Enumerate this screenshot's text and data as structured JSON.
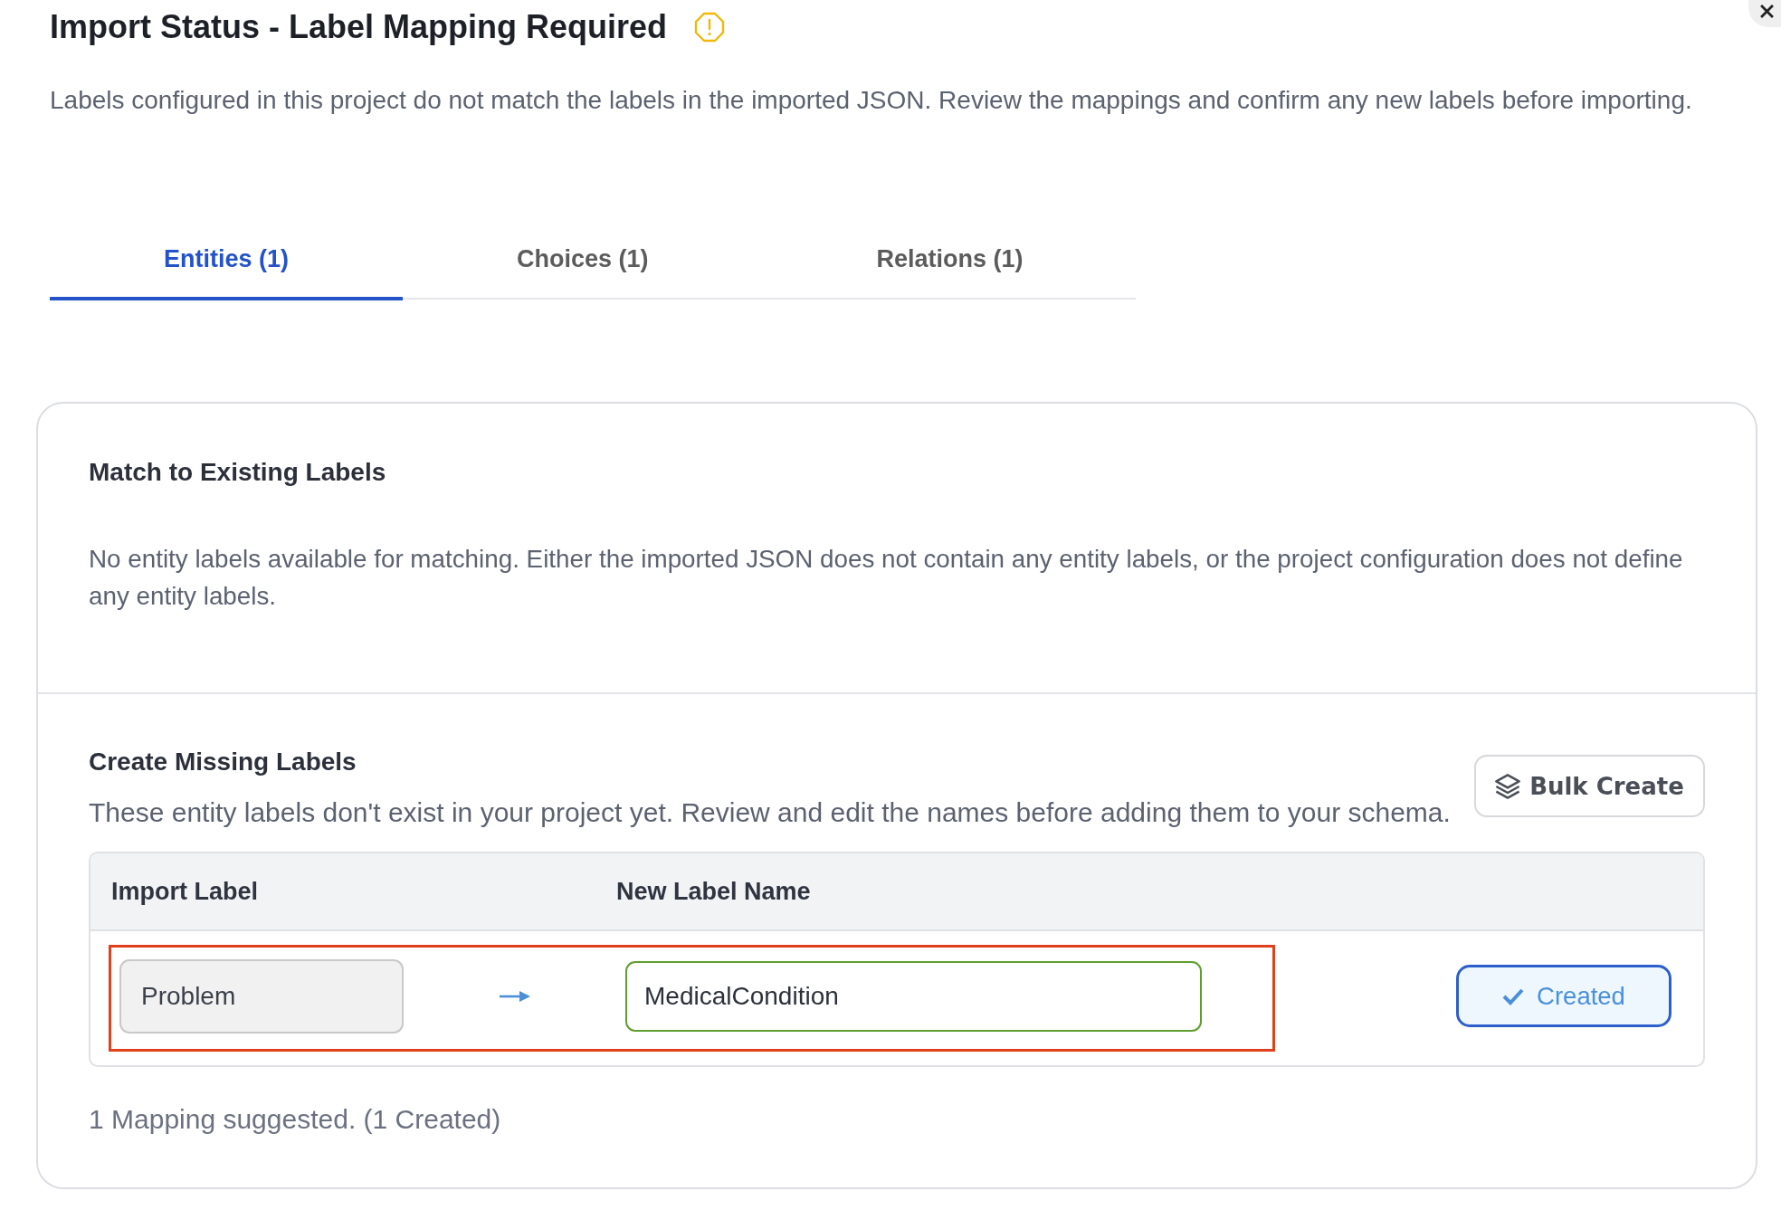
{
  "dialog": {
    "title": "Import Status - Label Mapping Required",
    "description": "Labels configured in this project do not match the labels in the imported JSON. Review the mappings and confirm any new labels before importing."
  },
  "tabs": [
    {
      "label": "Entities (1)",
      "selected": true
    },
    {
      "label": "Choices (1)",
      "selected": false
    },
    {
      "label": "Relations (1)",
      "selected": false
    }
  ],
  "match_section": {
    "title": "Match to Existing Labels",
    "message": "No entity labels available for matching. Either the imported JSON does not contain any entity labels, or the project configuration does not define any entity labels."
  },
  "create_section": {
    "title": "Create Missing Labels",
    "description": "These entity labels don't exist in your project yet. Review and edit the names before adding them to your schema.",
    "bulk_button": "Bulk Create",
    "table": {
      "columns": [
        "Import Label",
        "New Label Name"
      ],
      "rows": [
        {
          "import_label": "Problem",
          "import_editable": false,
          "new_label_name": "MedicalCondition",
          "name_valid": true,
          "highlighted": true,
          "status": "Created",
          "created": true
        }
      ]
    },
    "summary": "1 Mapping suggested. (1 Created)"
  }
}
